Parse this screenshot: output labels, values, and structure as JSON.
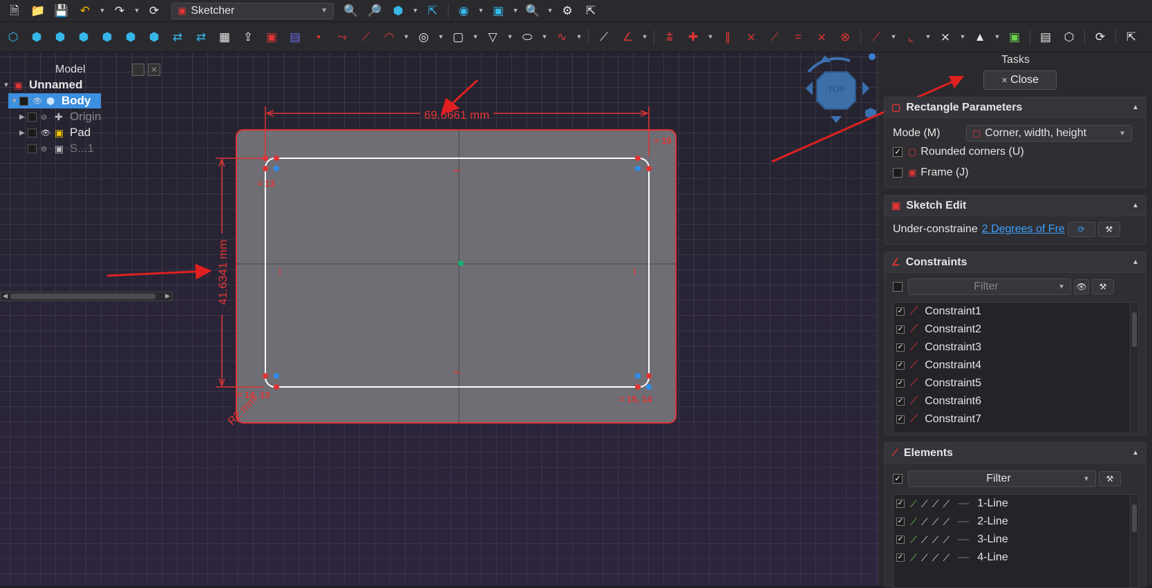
{
  "toolbar1": {
    "workbench": "Sketcher",
    "icons": [
      "new-file-icon",
      "open-file-icon",
      "save-icon",
      "undo-icon",
      "redo-icon",
      "refresh-icon",
      "fit-all-icon",
      "fit-selection-icon",
      "std-view-icon",
      "measure-icon",
      "draw-style-icon",
      "bounding-box-icon",
      "zoom-icon",
      "edit-icon",
      "whats-this-icon"
    ]
  },
  "toolbar2": {
    "icons": [
      "iso-view-icon",
      "front-view-icon",
      "top-view-icon",
      "right-view-icon",
      "rear-view-icon",
      "bottom-view-icon",
      "left-view-icon",
      "link-icon",
      "part-icon",
      "calculator-icon",
      "leave-sketch-icon",
      "view-sketch-icon",
      "view-section-icon",
      "point-icon",
      "polyline-icon",
      "line-icon",
      "arc-icon",
      "circle-icon",
      "rectangle-icon",
      "polygon-icon",
      "slot-icon",
      "bspline-icon",
      "construction-geometry-icon",
      "fillet-icon",
      "coincident-icon",
      "point-on-object-icon",
      "horizontal-vertical-icon",
      "parallel-icon",
      "perpendicular-icon",
      "tangent-icon",
      "equal-icon",
      "symmetric-icon",
      "block-icon",
      "dimension-icon",
      "lock-icon",
      "horizontal-distance-icon",
      "vertical-distance-icon",
      "distance-icon",
      "radius-icon",
      "angle-icon",
      "snell-icon",
      "toggle-driving-icon"
    ]
  },
  "model": {
    "title": "Model",
    "items": [
      {
        "label": "Unnamed"
      },
      {
        "label": "Body"
      },
      {
        "label": "Origin"
      },
      {
        "label": "Pad"
      },
      {
        "label": "S...1"
      }
    ]
  },
  "viewport": {
    "nav_cube_face": "TOP",
    "dim_width": "69.6661 mm",
    "dim_height": "41.6341 mm",
    "dim_radius": "R2 mm",
    "label_15": "= 15",
    "label_13": "= 13",
    "label_14_13": "= 14, 13",
    "label_15_14": "= 15, 14",
    "sketch_color": "#e03434",
    "geometry_color": "#ffffff"
  },
  "tasks": {
    "title": "Tasks",
    "close_label": "Close",
    "rect_params": {
      "title": "Rectangle Parameters",
      "mode_label": "Mode (M)",
      "mode_value": "Corner, width, height",
      "rounded_label": "Rounded corners (U)",
      "rounded_checked": true,
      "frame_label": "Frame (J)",
      "frame_checked": false
    },
    "sketch_edit": {
      "title": "Sketch Edit",
      "status_prefix": "Under-constraine",
      "status_link": "2 Degrees of Fre"
    },
    "constraints": {
      "title": "Constraints",
      "filter_placeholder": "Filter",
      "items": [
        "Constraint1",
        "Constraint2",
        "Constraint3",
        "Constraint4",
        "Constraint5",
        "Constraint6",
        "Constraint7"
      ]
    },
    "elements": {
      "title": "Elements",
      "filter_label": "Filter",
      "items": [
        "1-Line",
        "2-Line",
        "3-Line",
        "4-Line"
      ]
    }
  }
}
